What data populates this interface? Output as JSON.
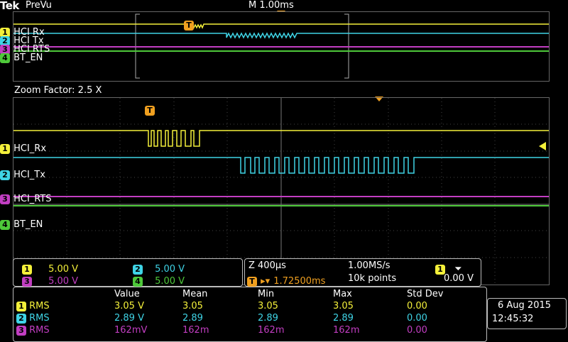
{
  "header": {
    "brand": "Tek",
    "mode": "PreVu",
    "timebase": "M 1.00ms"
  },
  "zoom": {
    "label": "Zoom Factor: 2.5 X"
  },
  "channels": [
    {
      "num": "1",
      "name": "HCI_Rx",
      "overview_name": "HCI  Rx",
      "color": "#f4f03a"
    },
    {
      "num": "2",
      "name": "HCI_Tx",
      "overview_name": "HCI  Tx",
      "color": "#3fd4e6"
    },
    {
      "num": "3",
      "name": "HCI_RTS",
      "overview_name": "HCI  RTS",
      "color": "#c23ec2"
    },
    {
      "num": "4",
      "name": "BT_EN",
      "overview_name": "BT_EN",
      "color": "#4ec93a"
    }
  ],
  "vertical": [
    {
      "num": "1",
      "scale": "5.00 V"
    },
    {
      "num": "2",
      "scale": "5.00 V"
    },
    {
      "num": "3",
      "scale": "5.00 V"
    },
    {
      "num": "4",
      "scale": "5.00 V"
    }
  ],
  "timing": {
    "zoom_scale": "Z 400µs",
    "sample_rate": "1.00MS/s",
    "trigger_pos": "1.72500ms",
    "record": "10k points",
    "trig_channel": "1",
    "trig_slope": "⏷",
    "trig_level": "0.00 V"
  },
  "measurements": {
    "headers": [
      "Value",
      "Mean",
      "Min",
      "Max",
      "Std Dev"
    ],
    "rows": [
      {
        "num": "1",
        "type": "RMS",
        "value": "3.05 V",
        "mean": "3.05",
        "min": "3.05",
        "max": "3.05",
        "std": "0.00"
      },
      {
        "num": "2",
        "type": "RMS",
        "value": "2.89 V",
        "mean": "2.89",
        "min": "2.89",
        "max": "2.89",
        "std": "0.00"
      },
      {
        "num": "3",
        "type": "RMS",
        "value": "162mV",
        "mean": "162m",
        "min": "162m",
        "max": "162m",
        "std": "0.00"
      }
    ]
  },
  "datetime": {
    "date": "6 Aug 2015",
    "time": "12:45:32"
  },
  "markers": {
    "trigger": "T"
  }
}
